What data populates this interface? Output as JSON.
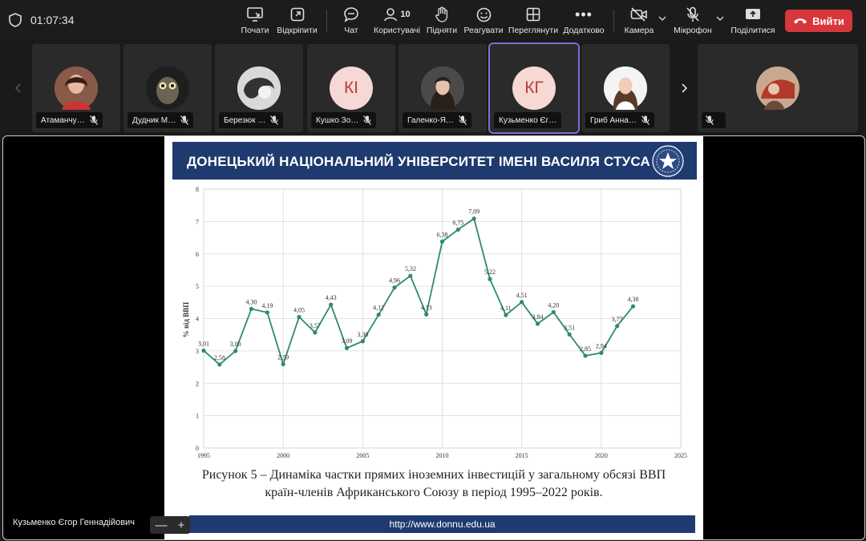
{
  "timer": "01:07:34",
  "toolbar": {
    "start": "Почати",
    "detach": "Відкріпити",
    "chat": "Чат",
    "users": "Користувачі",
    "users_count": "10",
    "raise": "Підняти",
    "react": "Реагувати",
    "view": "Переглянути",
    "more": "Додатково",
    "camera": "Камера",
    "mic": "Мікрофон",
    "share": "Поділитися",
    "leave": "Вийти"
  },
  "participants": [
    {
      "name": "Атаманчу…",
      "initials": ""
    },
    {
      "name": "Дудник М…",
      "initials": ""
    },
    {
      "name": "Березюк …",
      "initials": ""
    },
    {
      "name": "Кушко Зо…",
      "initials": "КІ"
    },
    {
      "name": "Галенко-Я…",
      "initials": ""
    },
    {
      "name": "Кузьменко Єг…",
      "initials": "КГ"
    },
    {
      "name": "Гриб Анна…",
      "initials": ""
    },
    {
      "name": "",
      "initials": ""
    }
  ],
  "slide": {
    "header": "ДОНЕЦЬКИЙ НАЦІОНАЛЬНИЙ УНІВЕРСИТЕТ ІМЕНІ ВАСИЛЯ СТУСА",
    "caption_line1": "Рисунок 5 – Динаміка частки прямих іноземних інвестицій у загальному обсязі ВВП",
    "caption_line2": "країн-членів Африканського Союзу в період 1995–2022 років.",
    "footer": "http://www.donnu.edu.ua"
  },
  "presenter": "Кузьменко Єгор Геннадійович",
  "zoom": {
    "minus": "—",
    "plus": "+"
  },
  "chart_data": {
    "type": "line",
    "title": "",
    "xlabel": "",
    "ylabel": "% від ВВП",
    "xlim": [
      1995,
      2025
    ],
    "ylim": [
      0,
      8
    ],
    "xticks": [
      1995,
      2000,
      2005,
      2010,
      2015,
      2020,
      2025
    ],
    "yticks": [
      0,
      1,
      2,
      3,
      4,
      5,
      6,
      7,
      8
    ],
    "grid": true,
    "color": "#2e8b6e",
    "series": [
      {
        "x": [
          1995,
          1996,
          1997,
          1998,
          1999,
          2000,
          2001,
          2002,
          2003,
          2004,
          2005,
          2006,
          2007,
          2008,
          2009,
          2010,
          2011,
          2012,
          2013,
          2014,
          2015,
          2016,
          2017,
          2018,
          2019,
          2020,
          2021,
          2022
        ],
        "y": [
          3.01,
          2.58,
          3.0,
          4.3,
          4.19,
          2.59,
          4.05,
          3.57,
          4.43,
          3.09,
          3.3,
          4.12,
          4.96,
          5.32,
          4.13,
          6.38,
          6.75,
          7.09,
          5.22,
          4.11,
          4.51,
          3.84,
          4.2,
          3.51,
          2.85,
          2.94,
          3.77,
          4.38
        ],
        "labels": [
          "3,01",
          "2,58",
          "3,00",
          "4,30",
          "4,19",
          "2,59",
          "4,05",
          "3,57",
          "4,43",
          "3,09",
          "3,30",
          "4,12",
          "4,96",
          "5,32",
          "4,13",
          "6,38",
          "6,75",
          "7,09",
          "5,22",
          "4,11",
          "4,51",
          "3,84",
          "4,20",
          "3,51",
          "2,85",
          "2,94",
          "3,77",
          "4,38"
        ]
      }
    ]
  }
}
